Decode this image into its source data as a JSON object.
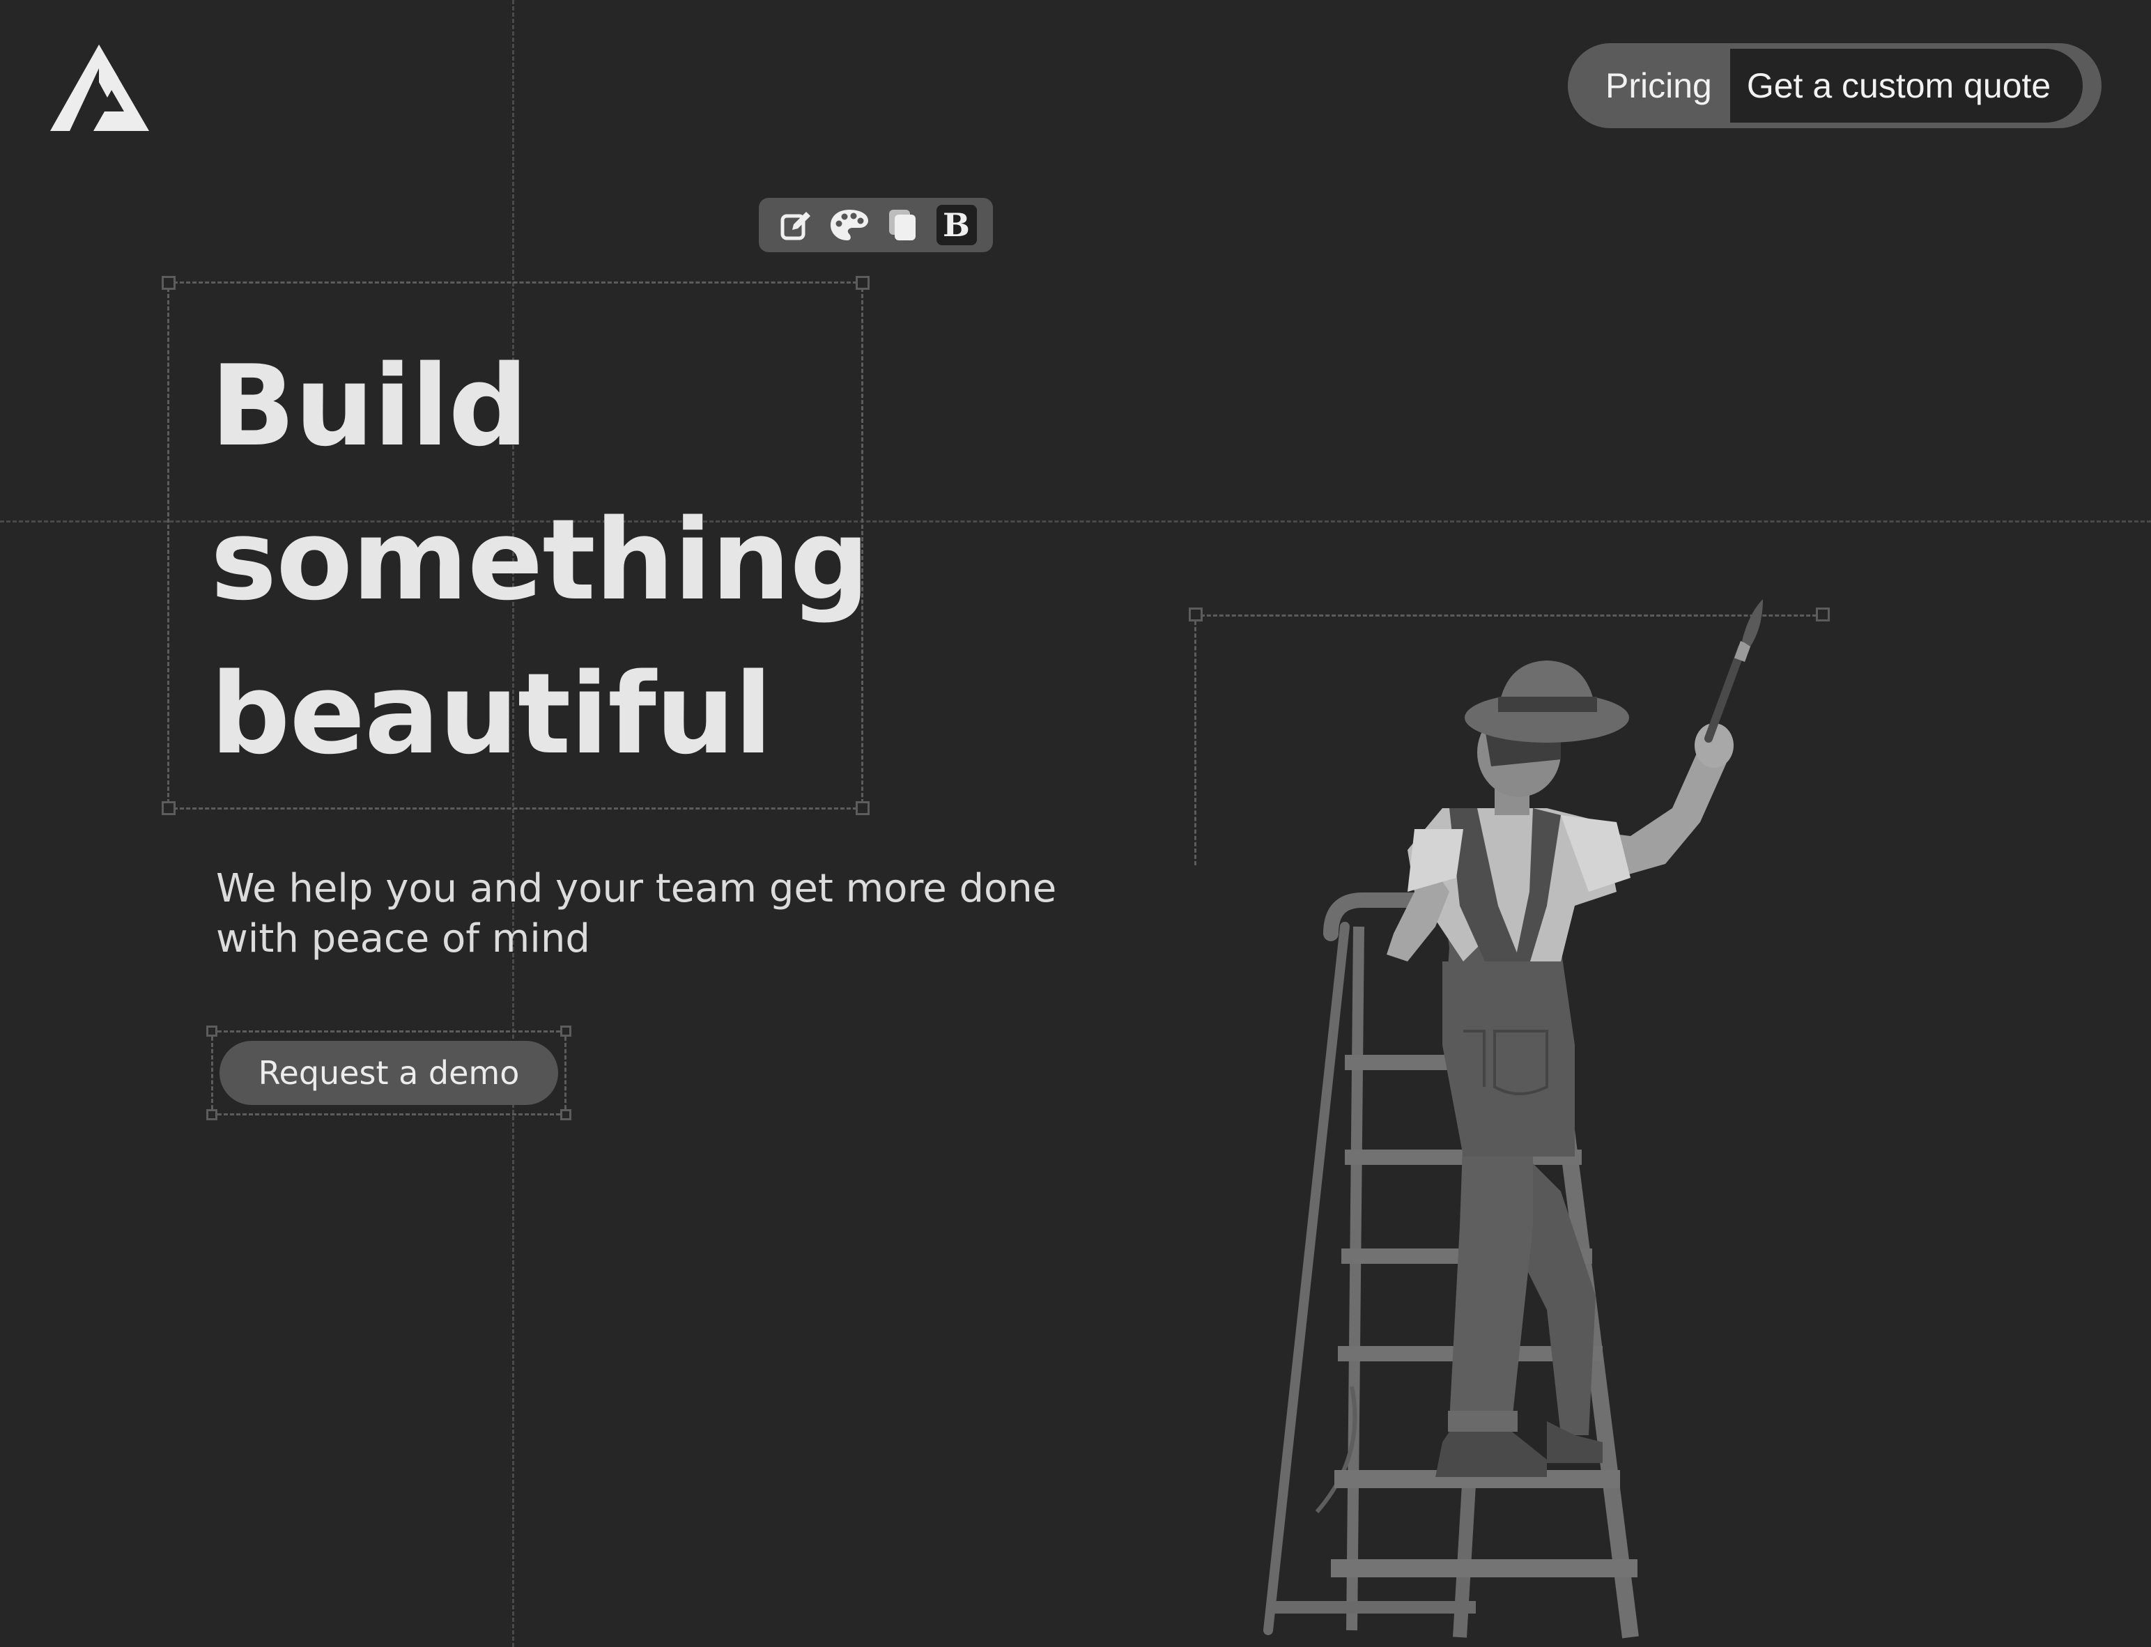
{
  "brand": {
    "logo_icon": "triangle-logo-icon"
  },
  "nav": {
    "pricing_label": "Pricing",
    "quote_label": "Get a custom quote"
  },
  "toolbar": {
    "edit_icon": "edit-icon",
    "palette_icon": "palette-icon",
    "duplicate_icon": "duplicate-icon",
    "bold_label": "B"
  },
  "hero": {
    "headline_line1": "Build",
    "headline_line2": "something",
    "headline_line3": "beautiful",
    "subtitle_line1": "We help you and your team get more done",
    "subtitle_line2": "with peace of mind",
    "cta_label": "Request a demo"
  },
  "illustration": {
    "name": "painter-on-ladder-illustration"
  },
  "colors": {
    "background": "#262626",
    "text": "#e6e6e6",
    "pill": "#5b5b5b",
    "pill_dark": "#232323",
    "guide": "#4a4a4a"
  }
}
